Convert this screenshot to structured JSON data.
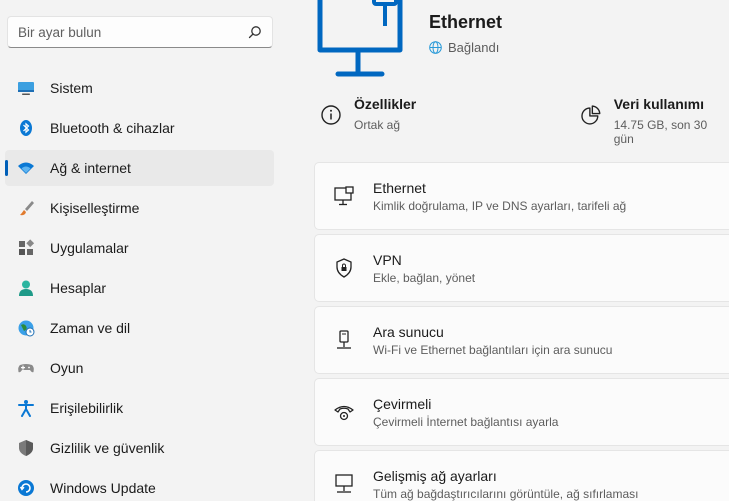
{
  "search": {
    "placeholder": "Bir ayar bulun"
  },
  "sidebar": {
    "items": [
      {
        "label": "Sistem",
        "icon": "monitor-icon"
      },
      {
        "label": "Bluetooth & cihazlar",
        "icon": "bluetooth-icon"
      },
      {
        "label": "Ağ & internet",
        "icon": "wifi-icon",
        "active": true
      },
      {
        "label": "Kişiselleştirme",
        "icon": "brush-icon"
      },
      {
        "label": "Uygulamalar",
        "icon": "apps-icon"
      },
      {
        "label": "Hesaplar",
        "icon": "person-icon"
      },
      {
        "label": "Zaman ve dil",
        "icon": "globe-clock-icon"
      },
      {
        "label": "Oyun",
        "icon": "gamepad-icon"
      },
      {
        "label": "Erişilebilirlik",
        "icon": "accessibility-icon"
      },
      {
        "label": "Gizlilik ve güvenlik",
        "icon": "shield-icon"
      },
      {
        "label": "Windows Update",
        "icon": "update-icon"
      }
    ]
  },
  "header": {
    "title": "Ethernet",
    "status": "Bağlandı"
  },
  "properties": {
    "title": "Özellikler",
    "subtitle": "Ortak ağ"
  },
  "data_usage": {
    "title": "Veri kullanımı",
    "subtitle": "14.75 GB, son 30 gün"
  },
  "cards": [
    {
      "title": "Ethernet",
      "subtitle": "Kimlik doğrulama, IP ve DNS ayarları, tarifeli ağ",
      "icon": "ethernet-icon"
    },
    {
      "title": "VPN",
      "subtitle": "Ekle, bağlan, yönet",
      "icon": "vpn-shield-icon"
    },
    {
      "title": "Ara sunucu",
      "subtitle": "Wi-Fi ve Ethernet bağlantıları için ara sunucu",
      "icon": "proxy-icon"
    },
    {
      "title": "Çevirmeli",
      "subtitle": "Çevirmeli İnternet bağlantısı ayarla",
      "icon": "dialup-icon"
    },
    {
      "title": "Gelişmiş ağ ayarları",
      "subtitle": "Tüm ağ bağdaştırıcılarını görüntüle, ağ sıfırlaması",
      "icon": "network-settings-icon"
    }
  ],
  "colors": {
    "accent": "#005fb8",
    "hero_icon": "#0067c0",
    "background": "#f3f3f3",
    "card": "#fbfbfb"
  }
}
